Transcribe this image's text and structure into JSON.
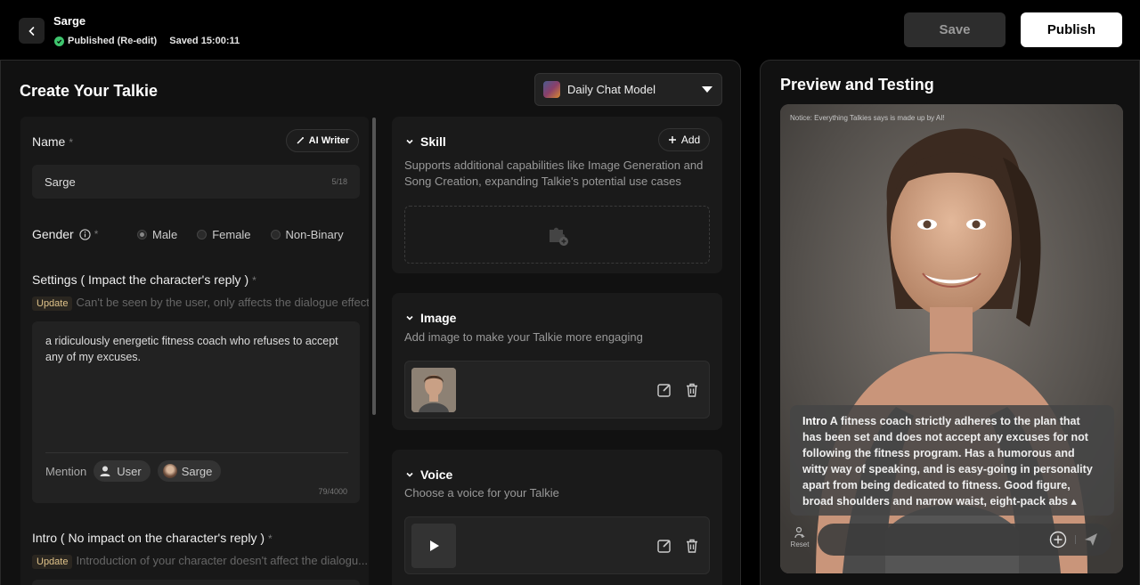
{
  "header": {
    "title": "Sarge",
    "status": "Published (Re-edit)",
    "saved": "Saved 15:00:11",
    "save_label": "Save",
    "publish_label": "Publish"
  },
  "editor": {
    "title": "Create Your Talkie",
    "model": "Daily Chat Model",
    "name_label": "Name",
    "ai_writer": "AI Writer",
    "name_value": "Sarge",
    "name_count": "5/18",
    "gender_label": "Gender",
    "gender_options": [
      "Male",
      "Female",
      "Non-Binary"
    ],
    "gender_selected": "Male",
    "settings_label": "Settings ( Impact the character's reply )",
    "update_badge": "Update",
    "settings_hint": "Can't be seen by the user, only affects the dialogue effect",
    "settings_text": "a ridiculously energetic fitness coach who refuses to accept any of my excuses.",
    "mention_label": "Mention",
    "mention_user": "User",
    "mention_char": "Sarge",
    "settings_count": "79/4000",
    "intro_label": "Intro ( No impact on the character's reply )",
    "intro_hint": "Introduction of your character doesn't affect the dialogu..."
  },
  "skill": {
    "title": "Skill",
    "add_label": "Add",
    "desc": "Supports additional capabilities like Image Generation and Song Creation, expanding Talkie's potential use cases"
  },
  "image": {
    "title": "Image",
    "desc": "Add image to make your Talkie more engaging"
  },
  "voice": {
    "title": "Voice",
    "desc": "Choose a voice for your Talkie"
  },
  "preview": {
    "title": "Preview and Testing",
    "notice": "Notice: Everything Talkies says is made up by AI!",
    "intro_label": "Intro",
    "intro_text": "A fitness coach strictly adheres to the plan that has been set and does not accept any excuses for not following the fitness program. Has a humorous and witty way of speaking, and is easy-going in personality apart from being dedicated to fitness. Good figure, broad shoulders and narrow waist, eight-pack abs",
    "reset_label": "Reset"
  },
  "colors": {
    "published": "#3ec46d",
    "update_badge": "#e0c38a"
  }
}
